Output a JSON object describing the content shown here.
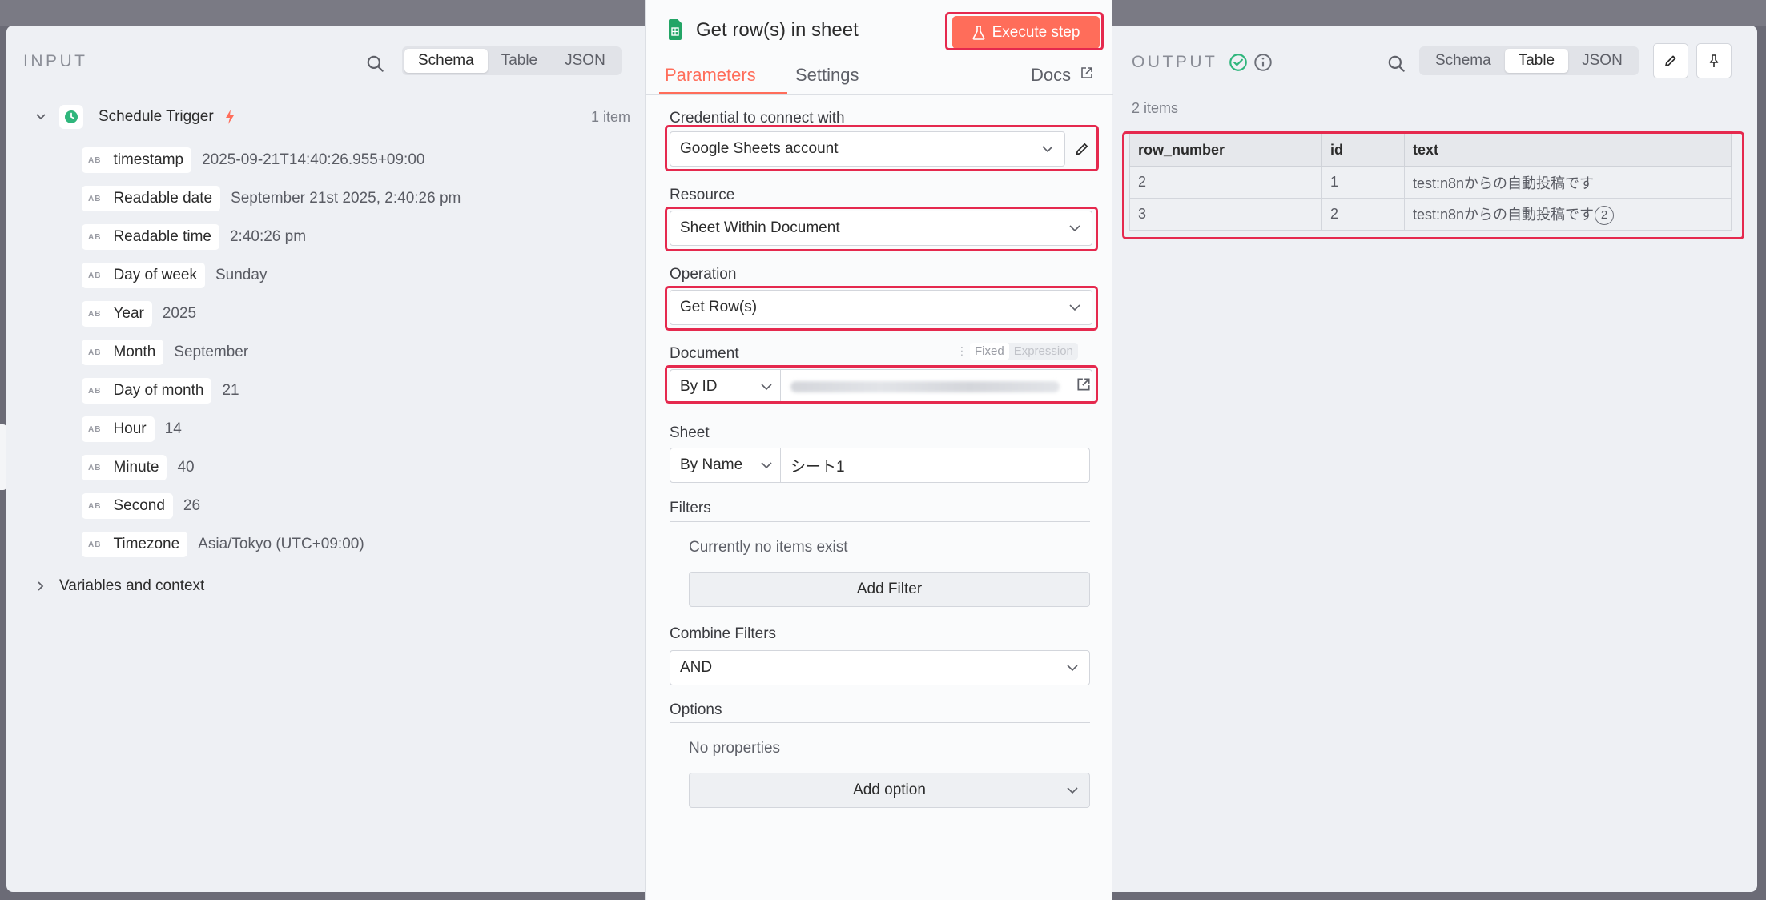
{
  "input": {
    "title": "INPUT",
    "view_options": [
      "Schema",
      "Table",
      "JSON"
    ],
    "active_view": "Schema",
    "node_name": "Schedule Trigger",
    "item_count": "1 item",
    "fields": [
      {
        "type": "AB",
        "name": "timestamp",
        "value": "2025-09-21T14:40:26.955+09:00"
      },
      {
        "type": "AB",
        "name": "Readable date",
        "value": "September 21st 2025, 2:40:26 pm"
      },
      {
        "type": "AB",
        "name": "Readable time",
        "value": "2:40:26 pm"
      },
      {
        "type": "AB",
        "name": "Day of week",
        "value": "Sunday"
      },
      {
        "type": "AB",
        "name": "Year",
        "value": "2025"
      },
      {
        "type": "AB",
        "name": "Month",
        "value": "September"
      },
      {
        "type": "AB",
        "name": "Day of month",
        "value": "21"
      },
      {
        "type": "AB",
        "name": "Hour",
        "value": "14"
      },
      {
        "type": "AB",
        "name": "Minute",
        "value": "40"
      },
      {
        "type": "AB",
        "name": "Second",
        "value": "26"
      },
      {
        "type": "AB",
        "name": "Timezone",
        "value": "Asia/Tokyo (UTC+09:00)"
      }
    ],
    "variables_label": "Variables and context"
  },
  "node": {
    "title": "Get row(s) in sheet",
    "execute_label": "Execute step",
    "tabs": [
      "Parameters",
      "Settings"
    ],
    "active_tab": "Parameters",
    "docs_label": "Docs",
    "credential_label": "Credential to connect with",
    "credential_value": "Google Sheets account",
    "resource_label": "Resource",
    "resource_value": "Sheet Within Document",
    "operation_label": "Operation",
    "operation_value": "Get Row(s)",
    "document_label": "Document",
    "fixed_label": "Fixed",
    "expression_label": "Expression",
    "document_mode": "By ID",
    "sheet_label": "Sheet",
    "sheet_mode": "By Name",
    "sheet_value": "シート1",
    "filters_label": "Filters",
    "filters_empty": "Currently no items exist",
    "add_filter_label": "Add Filter",
    "combine_label": "Combine Filters",
    "combine_value": "AND",
    "options_label": "Options",
    "options_empty": "No properties",
    "add_option_label": "Add option"
  },
  "output": {
    "title": "OUTPUT",
    "view_options": [
      "Schema",
      "Table",
      "JSON"
    ],
    "active_view": "Table",
    "item_count": "2 items",
    "columns": [
      "row_number",
      "id",
      "text"
    ],
    "rows": [
      [
        "2",
        "1",
        "test:n8nからの自動投稿です"
      ],
      [
        "3",
        "2",
        "test:n8nからの自動投稿です"
      ]
    ],
    "badge": "2"
  },
  "colors": {
    "accent": "#ff6d5a",
    "highlight_box": "#e5294e",
    "success": "#2fb67c",
    "trigger_icon": "#2fb67c",
    "sheets_green": "#23a566"
  }
}
